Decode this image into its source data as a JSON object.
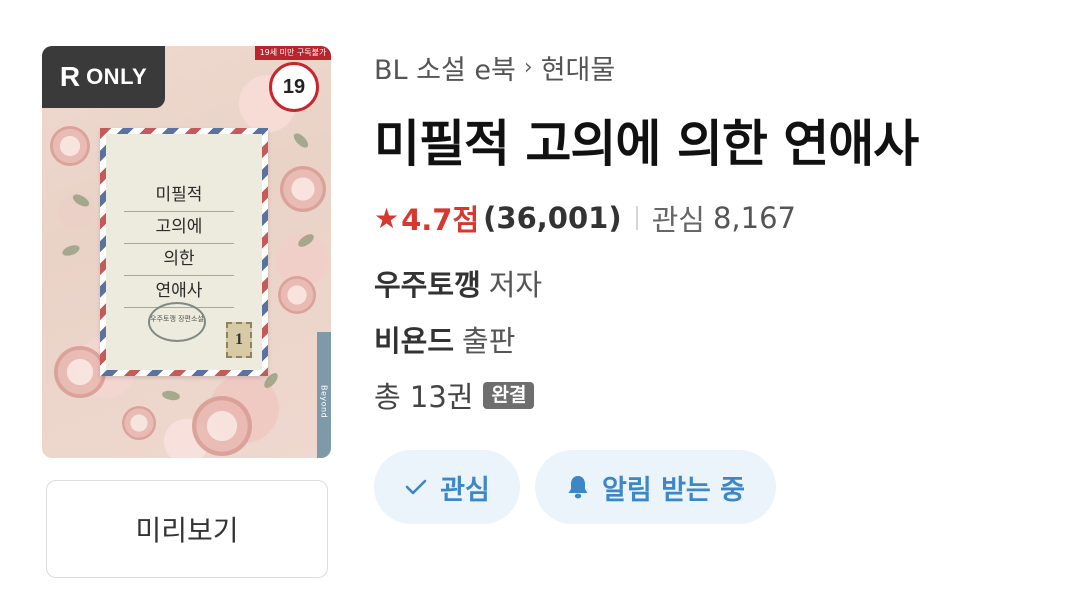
{
  "cover": {
    "badge_r": "R",
    "badge_only": "ONLY",
    "age_strip": "19세 미만 구독불가",
    "age_rating": "19",
    "title_lines": [
      "미필적",
      "고의에",
      "의한",
      "연애사"
    ],
    "postmark": "우주토깽\n장편소설",
    "stamp": "1",
    "publisher_tab": "Beyond"
  },
  "preview": {
    "label": "미리보기"
  },
  "breadcrumb": {
    "category": "BL 소설 e북",
    "separator": "›",
    "subcategory": "현대물"
  },
  "book": {
    "title": "미필적 고의에 의한 연애사"
  },
  "rating": {
    "star_icon": "star-icon",
    "score": "4.7점",
    "count": "(36,001)",
    "interest_label": "관심",
    "interest_count": "8,167"
  },
  "author": {
    "name": "우주토깽",
    "role": "저자"
  },
  "publisher": {
    "name": "비욘드",
    "role": "출판"
  },
  "volumes": {
    "text": "총 13권",
    "status": "완결"
  },
  "actions": {
    "interest_label": "관심",
    "alarm_label": "알림 받는 중"
  },
  "colors": {
    "accent_blue": "#3d87c6",
    "pill_bg": "#ebf4fb",
    "rating_red": "#d6382f",
    "age_red": "#c7262f"
  }
}
